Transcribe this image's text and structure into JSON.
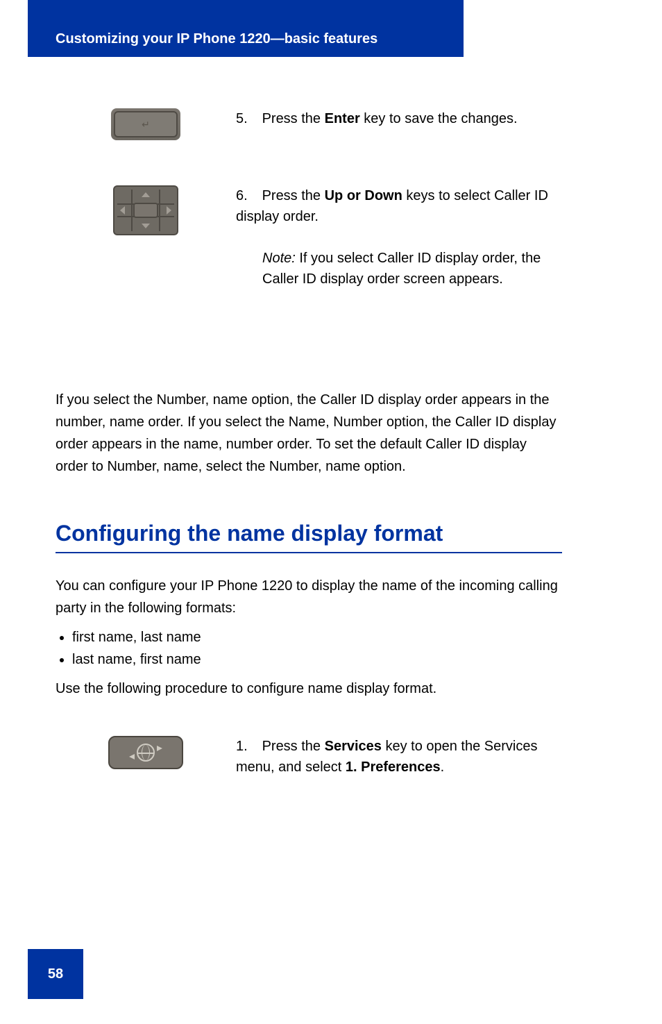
{
  "header": {
    "title": "Customizing your IP Phone 1220—basic features"
  },
  "step5": {
    "num": "5.",
    "prefix": "Press the ",
    "key": "Enter",
    "suffix": " key to save the changes."
  },
  "step6": {
    "num": "6.",
    "prefix": "Press the ",
    "key": "Up or Down",
    "suffix": " keys to select Caller ID display order.",
    "note_label": "Note:",
    "note_text": " If you select Caller ID display order, the Caller ID display order screen appears."
  },
  "body_para": "If you select the Number, name option, the Caller ID display order appears in the number, name order. If you select the Name, Number option, the Caller ID display order appears in the name, number order. To set the default Caller ID display order to Number, name, select the Number, name option.",
  "section_heading": "Configuring the name display format",
  "para2_a": "You can configure your IP Phone 1220 to display the name of the incoming calling party in the following formats:",
  "bullet1": "first name, last name",
  "bullet2": "last name, first name",
  "para2_b": "Use the following procedure to configure name display format.",
  "step1b": {
    "num": "1.",
    "prefix": "Press the ",
    "key": "Services",
    "suffix": " key to open the Services menu, and select ",
    "menu": "1. Preferences"
  },
  "page_number": "58"
}
